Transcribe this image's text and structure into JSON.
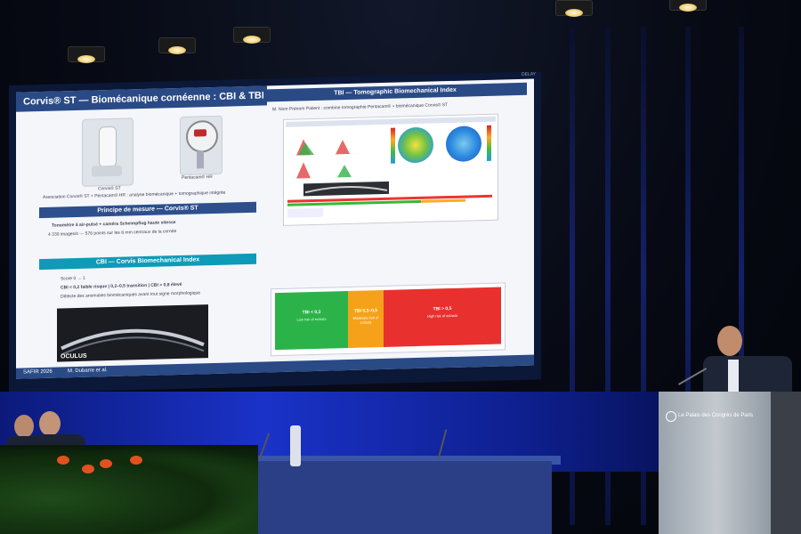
{
  "slide": {
    "title": "Corvis® ST — Biomécanique cornéenne : CBI & TBI",
    "left": {
      "device1_caption": "Corvis® ST",
      "device2_caption": "Pentacam® HR",
      "intro": "Association Corvis® ST + Pentacam® HR : analyse biomécanique + tomographique intégrée",
      "principle_title": "Principe de mesure — Corvis® ST",
      "principle_items": [
        "Tonomètre à air-pulsé + caméra Scheimpflug haute vitesse",
        "4 330 images/s — 576 points sur les 8 mm centraux de la cornée"
      ],
      "cbi_title": "CBI — Corvis Biomechanical Index",
      "cbi_items": [
        "Score 0 → 1",
        "CBI < 0,2 faible risque  |  0,2–0,5 transition  |  CBI > 0,8 élevé",
        "Détecte des anomalies biomécaniques avant tout signe morphologique"
      ],
      "brand": "OCULUS"
    },
    "right": {
      "tbi_title": "TBI — Tomographic Biomechanical Index",
      "tbi_bullet": "M. Nom Prénom Patient : combine tomographie Pentacam® + biomécanique Corvis® ST",
      "zones": [
        {
          "label": "TBI < 0,3",
          "desc": "Low risk of ectasia",
          "color": "#2bb34a"
        },
        {
          "label": "TBI 0,3–0,5",
          "desc": "Moderate risk of ectasia",
          "color": "#f5a21a"
        },
        {
          "label": "TBI > 0,5",
          "desc": "High risk of ectasia",
          "color": "#e8312f"
        }
      ]
    },
    "footer": {
      "left": "SAFIR 2026",
      "right": "M. Dubarre et al."
    },
    "corner_tag": "DELAY"
  },
  "podium_sign": "Le Palais des Congrès de Paris"
}
